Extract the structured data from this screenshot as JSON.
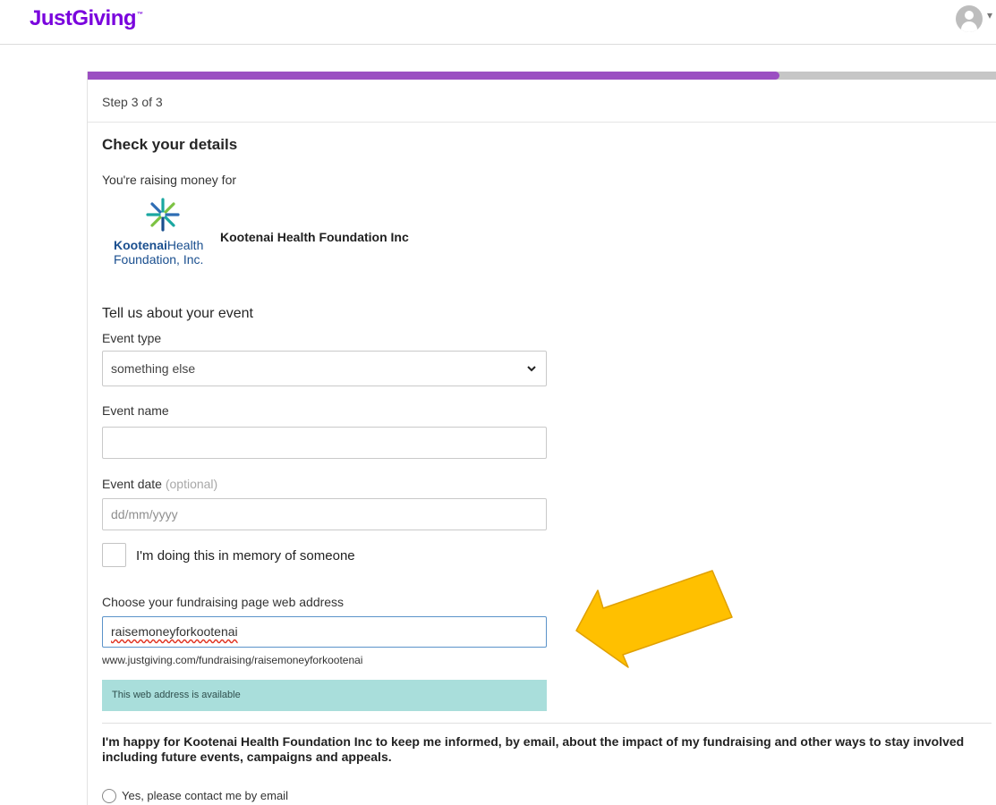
{
  "header": {
    "logo_text": "JustGiving",
    "logo_tm": "™",
    "brand_color": "#7a04dd",
    "account_icon": "user-avatar-icon"
  },
  "progress": {
    "fraction": 0.75,
    "step_label": "Step 3 of 3",
    "fill_color": "#9b4fc2",
    "track_color": "#c6c6c6"
  },
  "details": {
    "heading": "Check your details",
    "raising_label": "You're raising money for",
    "charity_name": "Kootenai Health Foundation Inc",
    "charity_logo": {
      "line1_bold": "Kootenai",
      "line1_rest": "Health",
      "line2": "Foundation, Inc."
    }
  },
  "event": {
    "heading": "Tell us about your event",
    "type_label": "Event type",
    "type_value": "something else",
    "name_label": "Event name",
    "name_value": "",
    "date_label": "Event date",
    "date_optional": "(optional)",
    "date_placeholder": "dd/mm/yyyy",
    "memory_label": "I'm doing this in memory of someone"
  },
  "web_address": {
    "label": "Choose your fundraising page web address",
    "value": "raisemoneyforkootenai",
    "preview": "www.justgiving.com/fundraising/raisemoneyforkootenai",
    "status": "This web address is available",
    "status_color": "#a9dedb"
  },
  "consent": {
    "text": "I'm happy for Kootenai Health Foundation Inc to keep me informed, by email, about the impact of my fundraising and other ways to stay involved including future events, campaigns and appeals.",
    "option_label": "Yes, please contact me by email"
  },
  "annotation": {
    "arrow_color": "#ffc000",
    "arrow_outline": "#e0a000"
  }
}
